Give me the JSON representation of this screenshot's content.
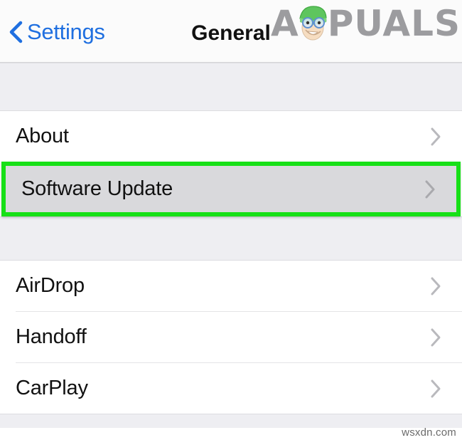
{
  "header": {
    "back_label": "Settings",
    "back_icon": "chevron-left-icon",
    "title": "General",
    "accent_color": "#1f6fe0",
    "title_color": "#111111",
    "background": "#fbfbfb"
  },
  "watermark": {
    "logo_prefix": "A",
    "logo_suffix": "PUALS",
    "logo_color": "#9b9b9e",
    "mascot_icon": "appuals-mascot-icon",
    "bottom_text": "wsxdn.com"
  },
  "sections": [
    {
      "id": "section-one",
      "rows": [
        {
          "label": "About",
          "chevron": "chevron-right-icon",
          "highlighted": false
        },
        {
          "label": "Software Update",
          "chevron": "chevron-right-icon",
          "highlighted": true
        }
      ]
    },
    {
      "id": "section-two",
      "rows": [
        {
          "label": "AirDrop",
          "chevron": "chevron-right-icon",
          "highlighted": false
        },
        {
          "label": "Handoff",
          "chevron": "chevron-right-icon",
          "highlighted": false
        },
        {
          "label": "CarPlay",
          "chevron": "chevron-right-icon",
          "highlighted": false
        }
      ]
    }
  ],
  "annotation": {
    "highlight_color": "#17e017",
    "highlight_target": "Software Update",
    "highlight_fill": "#d9d9dc"
  },
  "colors": {
    "row_background": "#ffffff",
    "gap_background": "#eeeef2",
    "separator": "#e4e4e6",
    "chevron": "#b9b9bd"
  }
}
